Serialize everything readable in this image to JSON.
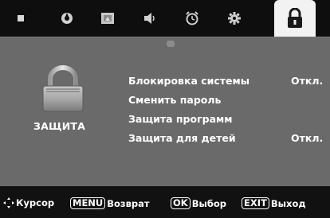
{
  "tabs": [
    {
      "icon": "picture-icon",
      "active": false
    },
    {
      "icon": "sound-icon",
      "active": false
    },
    {
      "icon": "channel-icon",
      "active": false
    },
    {
      "icon": "speaker-icon",
      "active": false
    },
    {
      "icon": "timer-clock-icon",
      "active": false
    },
    {
      "icon": "settings-gear-icon",
      "active": false
    },
    {
      "icon": "lock-icon",
      "active": true
    }
  ],
  "section": {
    "title": "ЗАЩИТА",
    "icon": "padlock-icon"
  },
  "menu": {
    "items": [
      {
        "label": "Блокировка системы",
        "value": "Откл."
      },
      {
        "label": "Сменить пароль",
        "value": ""
      },
      {
        "label": "Защита программ",
        "value": ""
      },
      {
        "label": "Защита для детей",
        "value": "Откл."
      }
    ]
  },
  "footer": {
    "cursor_label": "Курсор",
    "menu_key": "MENU",
    "menu_label": "Возврат",
    "ok_key": "OK",
    "ok_label": "Выбор",
    "exit_key": "EXIT",
    "exit_label": "Выход"
  },
  "colors": {
    "panel": "#6a6a6a",
    "tabbar": "#0e0e0e",
    "active_tab": "#f2f2f2",
    "text": "#ffffff"
  }
}
